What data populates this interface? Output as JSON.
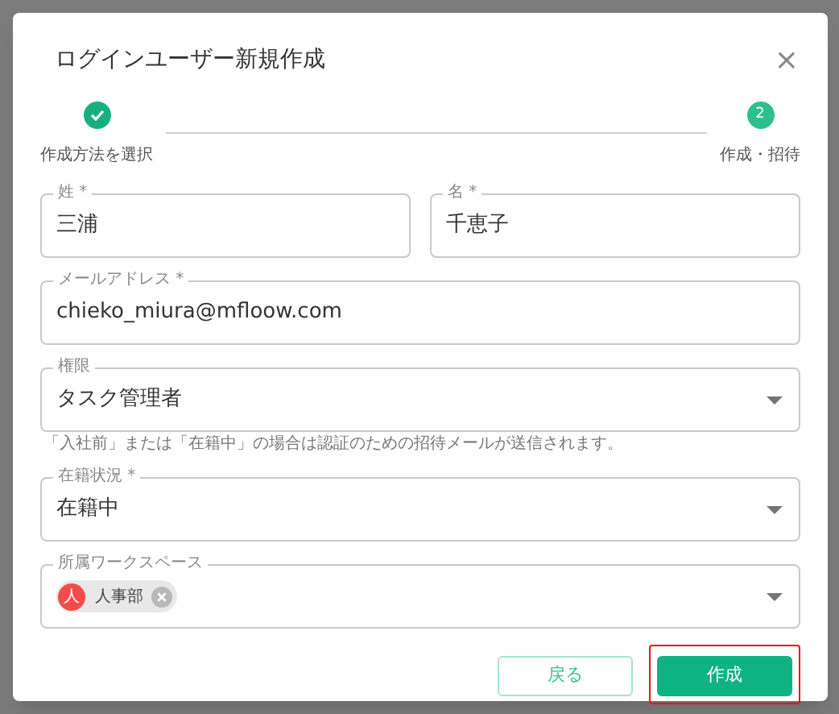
{
  "dialog": {
    "title": "ログインユーザー新規作成",
    "close": "×"
  },
  "steps": [
    {
      "label": "作成方法を選択",
      "completed": true
    },
    {
      "label": "作成・招待",
      "number": "2",
      "completed": false
    }
  ],
  "fields": [
    {
      "kind": "text",
      "label": "姓",
      "required_mark": "*",
      "value": "三浦"
    },
    {
      "kind": "text",
      "label": "名",
      "required_mark": "*",
      "value": "千恵子"
    },
    {
      "kind": "text",
      "label": "メールアドレス",
      "required_mark": "*",
      "value": "chieko_miura@mfloow.com"
    },
    {
      "kind": "select",
      "label": "権限",
      "value": "タスク管理者",
      "helper": "「入社前」または「在籍中」の場合は認証のための招待メールが送信されます。"
    },
    {
      "kind": "select",
      "label": "在籍状況",
      "required_mark": "*",
      "value": "在籍中"
    },
    {
      "kind": "chips",
      "label": "所属ワークスペース",
      "chips": [
        {
          "avatar": "人",
          "label": "人事部",
          "color": "#f44c4c"
        }
      ]
    }
  ],
  "buttons": [
    {
      "label": "戻る",
      "kind": "outlined",
      "highlighted": false
    },
    {
      "label": "作成",
      "kind": "primary",
      "highlighted": true
    }
  ]
}
